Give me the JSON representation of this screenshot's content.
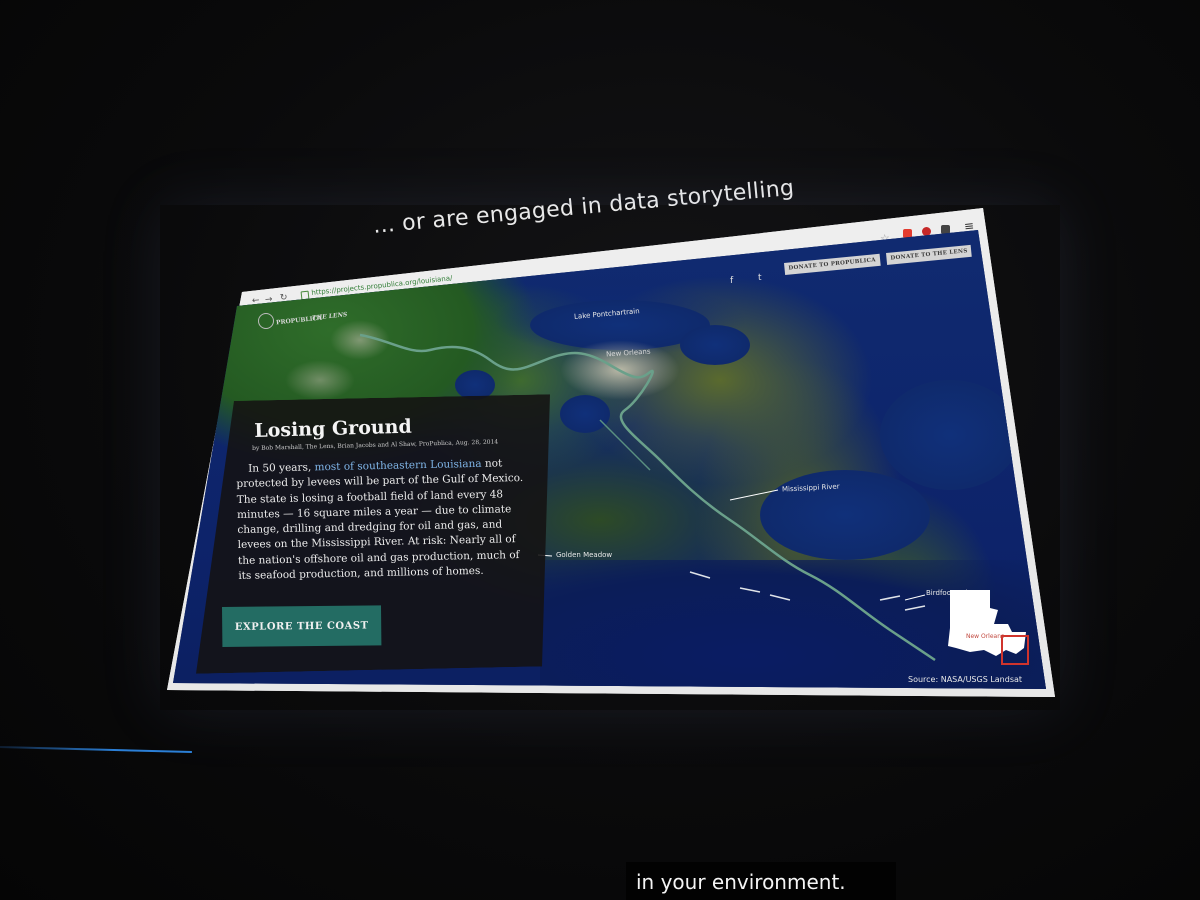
{
  "slide": {
    "caption": "... or are engaged in data storytelling"
  },
  "browser": {
    "url": "https://projects.propublica.org/louisiana/",
    "back_glyph": "←",
    "forward_glyph": "→",
    "reload_glyph": "↻",
    "star_glyph": "☆",
    "menu_glyph": "≡"
  },
  "site": {
    "brand_propublica": "PROPUBLICA",
    "brand_lens": "THE LENS",
    "facebook_glyph": "f",
    "twitter_glyph": "t",
    "donate_propublica": "DONATE TO PROPUBLICA",
    "donate_lens": "DONATE TO THE LENS"
  },
  "map": {
    "labels": {
      "lake": "Lake Pontchartrain",
      "city": "New Orleans",
      "river": "Mississippi River",
      "town": "Golden Meadow",
      "delta": "Birdfoot Delta",
      "inset_city": "New Orleans"
    },
    "source": "Source: NASA/USGS Landsat"
  },
  "story": {
    "title": "Losing Ground",
    "byline": "by Bob Marshall, The Lens, Brian Jacobs and Al Shaw, ProPublica, Aug. 28, 2014",
    "body_lines": [
      {
        "pre": "In 50 years, ",
        "link": "most of southeastern Louisiana",
        "post": " not"
      },
      {
        "pre": "protected by levees will be part of the Gulf of Mexico."
      },
      {
        "pre": "The state is losing a football field of land every 48"
      },
      {
        "pre": "minutes — 16 square miles a year — due to climate"
      },
      {
        "pre": "change, drilling and dredging for oil and gas, and"
      },
      {
        "pre": "levees on the Mississippi River. At risk: Nearly all of"
      },
      {
        "pre": "the nation's offshore oil and gas production, much of"
      },
      {
        "pre": "its seafood production, and millions of homes."
      }
    ],
    "cta_label": "EXPLORE THE COAST"
  },
  "overlay": {
    "subtitle": "in your environment."
  },
  "colors": {
    "cta": "#236c63",
    "link": "#7fb4e6",
    "url_green": "#35803a",
    "streak": "#2b7fd6"
  }
}
